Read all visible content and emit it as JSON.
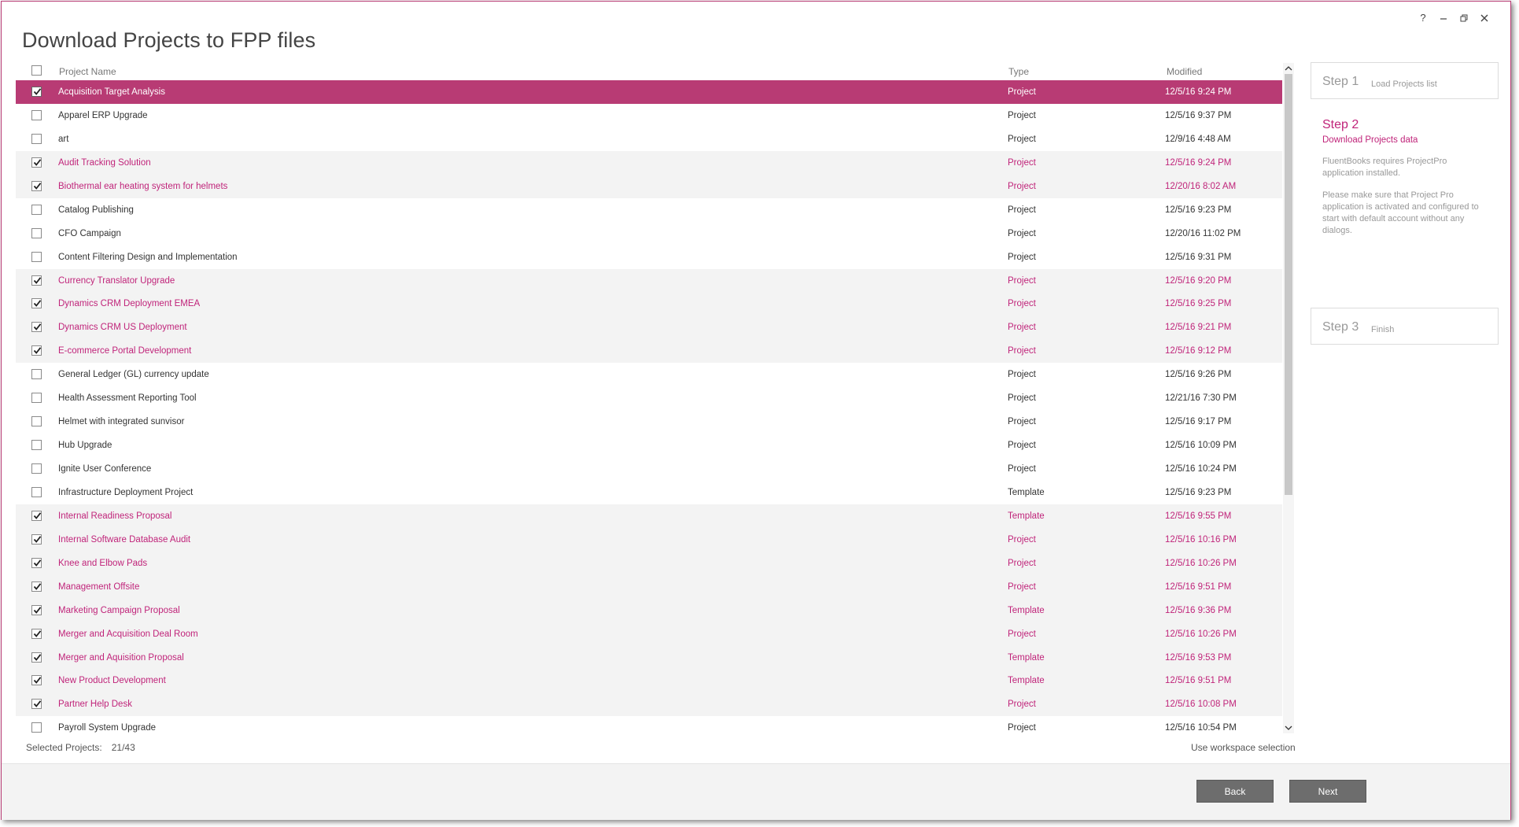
{
  "window": {
    "title": "Download Projects to FPP files",
    "controls": [
      "help-icon",
      "minimize-icon",
      "restore-icon",
      "close-icon"
    ],
    "help_glyph": "?"
  },
  "grid": {
    "headers": {
      "name": "Project Name",
      "type": "Type",
      "modified": "Modified"
    },
    "rows": [
      {
        "name": "Acquisition Target Analysis",
        "type": "Project",
        "modified": "12/5/16 9:24 PM",
        "checked": true,
        "selected": true
      },
      {
        "name": "Apparel ERP Upgrade",
        "type": "Project",
        "modified": "12/5/16 9:37 PM",
        "checked": false
      },
      {
        "name": "art",
        "type": "Project",
        "modified": "12/9/16 4:48 AM",
        "checked": false
      },
      {
        "name": "Audit Tracking Solution",
        "type": "Project",
        "modified": "12/5/16 9:24 PM",
        "checked": true
      },
      {
        "name": "Biothermal ear heating system for helmets",
        "type": "Project",
        "modified": "12/20/16 8:02 AM",
        "checked": true
      },
      {
        "name": "Catalog Publishing",
        "type": "Project",
        "modified": "12/5/16 9:23 PM",
        "checked": false
      },
      {
        "name": "CFO Campaign",
        "type": "Project",
        "modified": "12/20/16 11:02 PM",
        "checked": false
      },
      {
        "name": "Content Filtering Design and Implementation",
        "type": "Project",
        "modified": "12/5/16 9:31 PM",
        "checked": false
      },
      {
        "name": "Currency Translator Upgrade",
        "type": "Project",
        "modified": "12/5/16 9:20 PM",
        "checked": true
      },
      {
        "name": "Dynamics CRM Deployment EMEA",
        "type": "Project",
        "modified": "12/5/16 9:25 PM",
        "checked": true
      },
      {
        "name": "Dynamics CRM US Deployment",
        "type": "Project",
        "modified": "12/5/16 9:21 PM",
        "checked": true
      },
      {
        "name": "E-commerce Portal Development",
        "type": "Project",
        "modified": "12/5/16 9:12 PM",
        "checked": true
      },
      {
        "name": "General Ledger (GL) currency update",
        "type": "Project",
        "modified": "12/5/16 9:26 PM",
        "checked": false
      },
      {
        "name": "Health Assessment Reporting Tool",
        "type": "Project",
        "modified": "12/21/16 7:30 PM",
        "checked": false
      },
      {
        "name": "Helmet with integrated sunvisor",
        "type": "Project",
        "modified": "12/5/16 9:17 PM",
        "checked": false
      },
      {
        "name": "Hub Upgrade",
        "type": "Project",
        "modified": "12/5/16 10:09 PM",
        "checked": false
      },
      {
        "name": "Ignite User Conference",
        "type": "Project",
        "modified": "12/5/16 10:24 PM",
        "checked": false
      },
      {
        "name": "Infrastructure Deployment Project",
        "type": "Template",
        "modified": "12/5/16 9:23 PM",
        "checked": false
      },
      {
        "name": "Internal Readiness Proposal",
        "type": "Template",
        "modified": "12/5/16 9:55 PM",
        "checked": true
      },
      {
        "name": "Internal Software Database Audit",
        "type": "Project",
        "modified": "12/5/16 10:16 PM",
        "checked": true
      },
      {
        "name": "Knee and Elbow Pads",
        "type": "Project",
        "modified": "12/5/16 10:26 PM",
        "checked": true
      },
      {
        "name": "Management Offsite",
        "type": "Project",
        "modified": "12/5/16 9:51 PM",
        "checked": true
      },
      {
        "name": "Marketing Campaign Proposal",
        "type": "Template",
        "modified": "12/5/16 9:36 PM",
        "checked": true
      },
      {
        "name": "Merger and Acquisition Deal Room",
        "type": "Project",
        "modified": "12/5/16 10:26 PM",
        "checked": true
      },
      {
        "name": "Merger and Aquisition Proposal",
        "type": "Template",
        "modified": "12/5/16 9:53 PM",
        "checked": true
      },
      {
        "name": "New Product Development",
        "type": "Template",
        "modified": "12/5/16 9:51 PM",
        "checked": true
      },
      {
        "name": "Partner Help Desk",
        "type": "Project",
        "modified": "12/5/16 10:08 PM",
        "checked": true
      },
      {
        "name": "Payroll System Upgrade",
        "type": "Project",
        "modified": "12/5/16 10:54 PM",
        "checked": false
      }
    ]
  },
  "footer": {
    "selected_label": "Selected Projects:",
    "selected_count": "21/43",
    "workspace_link": "Use workspace selection"
  },
  "steps": {
    "step1": {
      "title": "Step 1",
      "subtitle": "Load Projects list"
    },
    "step2": {
      "title": "Step 2",
      "subtitle": "Download Projects data",
      "note1": "FluentBooks requires ProjectPro application installed.",
      "note2": "Please make sure that Project Pro application is activated and configured to start with default account without any dialogs."
    },
    "step3": {
      "title": "Step 3",
      "subtitle": "Finish"
    }
  },
  "buttons": {
    "back": "Back",
    "next": "Next"
  },
  "colors": {
    "accent": "#b83b74",
    "checked_text": "#c0247a",
    "button_bg": "#6d6d6d"
  }
}
